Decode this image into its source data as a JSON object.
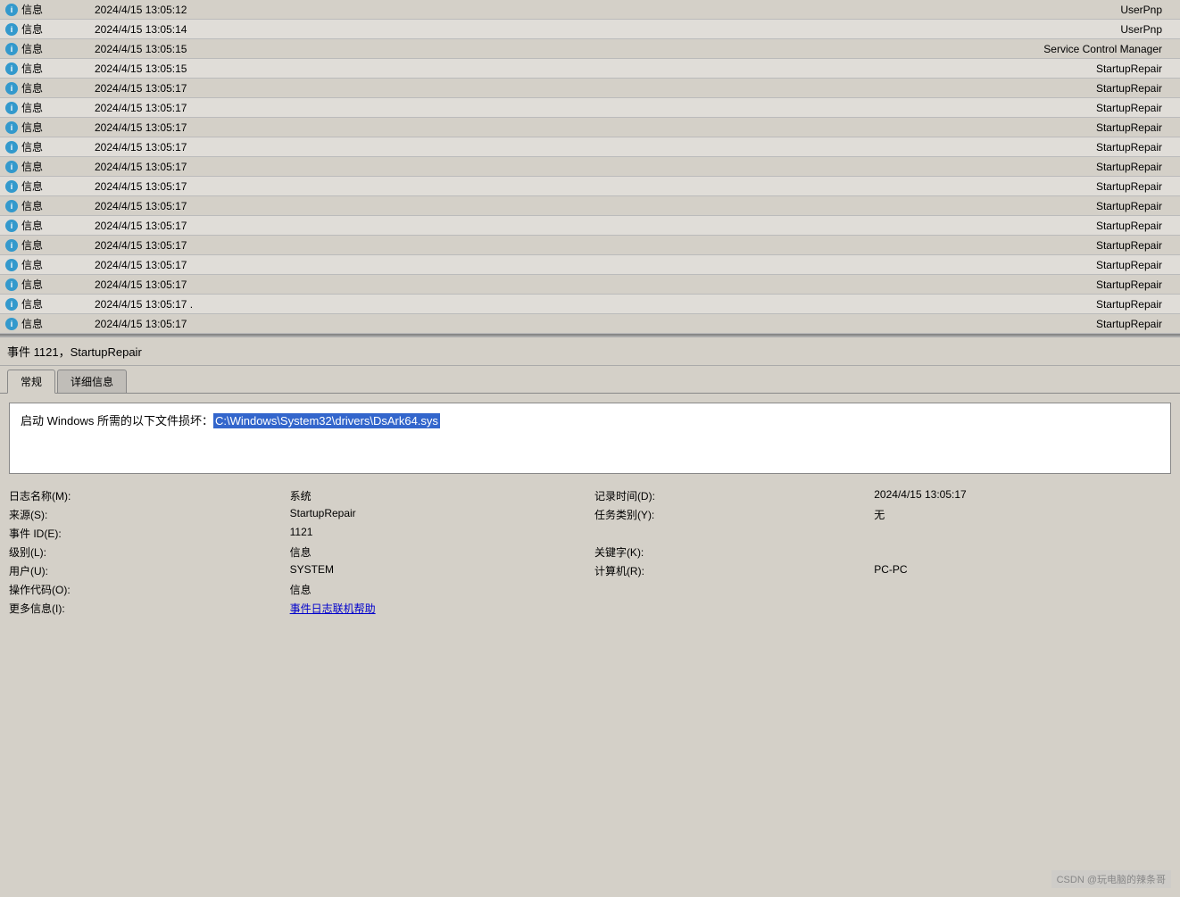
{
  "log": {
    "rows": [
      {
        "level": "信息",
        "datetime": "2024/4/15 13:05:12",
        "source": "UserPnp"
      },
      {
        "level": "信息",
        "datetime": "2024/4/15 13:05:14",
        "source": "UserPnp"
      },
      {
        "level": "信息",
        "datetime": "2024/4/15 13:05:15",
        "source": "Service Control Manager"
      },
      {
        "level": "信息",
        "datetime": "2024/4/15 13:05:15",
        "source": "StartupRepair"
      },
      {
        "level": "信息",
        "datetime": "2024/4/15 13:05:17",
        "source": "StartupRepair"
      },
      {
        "level": "信息",
        "datetime": "2024/4/15 13:05:17",
        "source": "StartupRepair"
      },
      {
        "level": "信息",
        "datetime": "2024/4/15 13:05:17",
        "source": "StartupRepair"
      },
      {
        "level": "信息",
        "datetime": "2024/4/15 13:05:17",
        "source": "StartupRepair"
      },
      {
        "level": "信息",
        "datetime": "2024/4/15 13:05:17",
        "source": "StartupRepair"
      },
      {
        "level": "信息",
        "datetime": "2024/4/15 13:05:17",
        "source": "StartupRepair"
      },
      {
        "level": "信息",
        "datetime": "2024/4/15 13:05:17",
        "source": "StartupRepair"
      },
      {
        "level": "信息",
        "datetime": "2024/4/15 13:05:17",
        "source": "StartupRepair"
      },
      {
        "level": "信息",
        "datetime": "2024/4/15 13:05:17",
        "source": "StartupRepair"
      },
      {
        "level": "信息",
        "datetime": "2024/4/15 13:05:17",
        "source": "StartupRepair"
      },
      {
        "level": "信息",
        "datetime": "2024/4/15 13:05:17",
        "source": "StartupRepair"
      },
      {
        "level": "信息",
        "datetime": "2024/4/15 13:05:17 .",
        "source": "StartupRepair"
      },
      {
        "level": "信息",
        "datetime": "2024/4/15 13:05:17",
        "source": "StartupRepair"
      }
    ]
  },
  "detail": {
    "event_title": "事件 1121，StartupRepair",
    "tabs": [
      "常规",
      "详细信息"
    ],
    "active_tab": "常规",
    "message_prefix": "启动 Windows 所需的以下文件损坏：",
    "highlighted_path": "C:\\Windows\\System32\\drivers\\DsArk64.sys",
    "fields": {
      "log_name_label": "日志名称(M):",
      "log_name_value": "系统",
      "source_label": "来源(S):",
      "source_value": "StartupRepair",
      "record_time_label": "记录时间(D):",
      "record_time_value": "2024/4/15 13:05:17",
      "event_id_label": "事件 ID(E):",
      "event_id_value": "1121",
      "task_category_label": "任务类别(Y):",
      "task_category_value": "无",
      "level_label": "级别(L):",
      "level_value": "信息",
      "keyword_label": "关键字(K):",
      "keyword_value": "",
      "user_label": "用户(U):",
      "user_value": "SYSTEM",
      "computer_label": "计算机(R):",
      "computer_value": "PC-PC",
      "op_code_label": "操作代码(O):",
      "op_code_value": "信息",
      "more_info_label": "更多信息(I):",
      "more_info_link": "事件日志联机帮助"
    }
  },
  "watermark": "CSDN @玩电脑的辣条哥"
}
